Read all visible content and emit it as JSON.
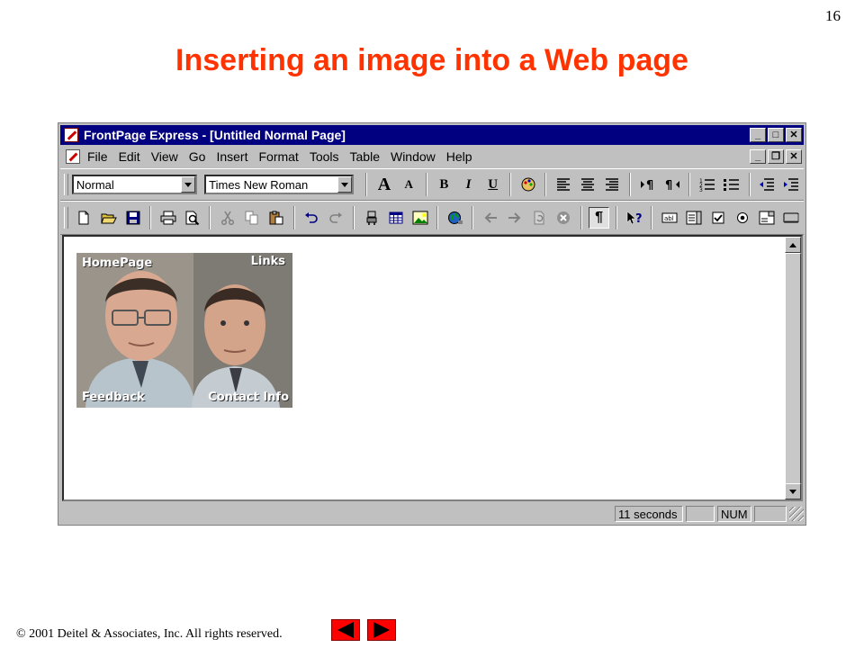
{
  "slide": {
    "number": "16",
    "title": "Inserting an image into a Web page",
    "footer": "© 2001 Deitel & Associates, Inc.  All rights reserved."
  },
  "window": {
    "title": "FrontPage Express - [Untitled Normal Page]",
    "controls": {
      "minimize": "_",
      "maximize": "□",
      "close": "✕",
      "restore": "❐"
    }
  },
  "menu": {
    "items": [
      "File",
      "Edit",
      "View",
      "Go",
      "Insert",
      "Format",
      "Tools",
      "Table",
      "Window",
      "Help"
    ]
  },
  "format_toolbar": {
    "style_value": "Normal",
    "font_value": "Times New Roman",
    "increase_font": "A",
    "decrease_font": "A",
    "bold": "B",
    "italic": "I",
    "underline": "U"
  },
  "standard_toolbar": {
    "show_all_label": "¶"
  },
  "image": {
    "labels": {
      "top_left": "HomePage",
      "top_right": "Links",
      "bottom_left": "Feedback",
      "bottom_right": "Contact Info"
    }
  },
  "status": {
    "load_time": "11 seconds",
    "num_lock": "NUM"
  },
  "colors": {
    "title": "#ff3300",
    "titlebar": "#000080",
    "nav_button": "#ff0000"
  }
}
